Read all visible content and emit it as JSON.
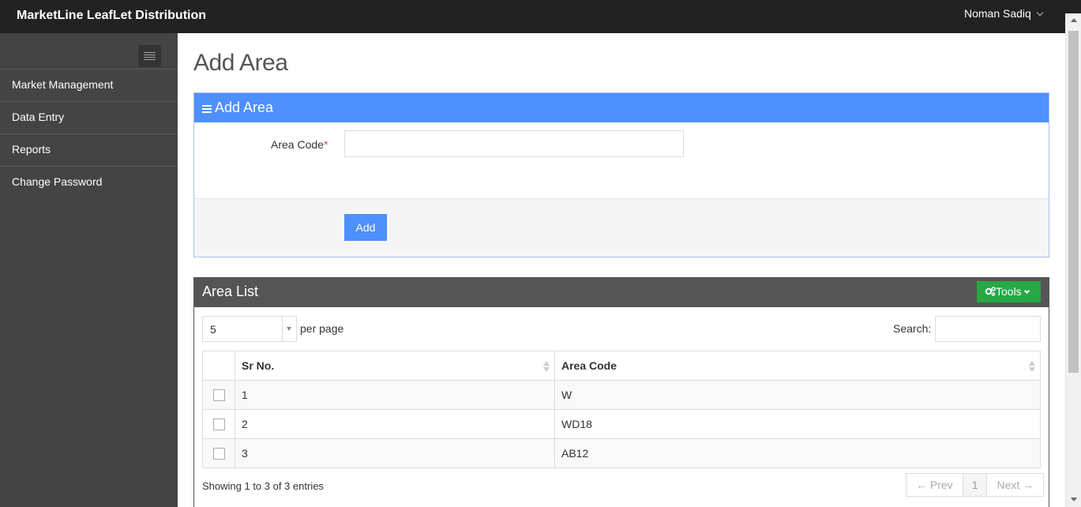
{
  "header": {
    "brand": "MarketLine LeafLet Distribution",
    "user": "Noman Sadiq"
  },
  "sidebar": {
    "items": [
      {
        "label": "Market Management"
      },
      {
        "label": "Data Entry"
      },
      {
        "label": "Reports"
      },
      {
        "label": "Change Password"
      }
    ]
  },
  "page": {
    "title": "Add Area"
  },
  "form": {
    "title": "Add Area",
    "area_code_label": "Area Code",
    "required_mark": "*",
    "area_code_value": "",
    "add_label": "Add",
    "accent": "#4d90fe"
  },
  "list": {
    "title": "Area List",
    "tools_label": "Tools",
    "per_page_value": "5",
    "per_page_label": "per page",
    "search_label": "Search:",
    "search_value": "",
    "columns": [
      "Sr No.",
      "Area Code"
    ],
    "rows": [
      {
        "sr": "1",
        "code": "W"
      },
      {
        "sr": "2",
        "code": "WD18"
      },
      {
        "sr": "3",
        "code": "AB12"
      }
    ],
    "showing": "Showing 1 to 3 of 3 entries",
    "pager": {
      "prev": "← Prev",
      "current": "1",
      "next": "Next →"
    },
    "tools_color": "#28a745",
    "header_color": "#555555"
  }
}
